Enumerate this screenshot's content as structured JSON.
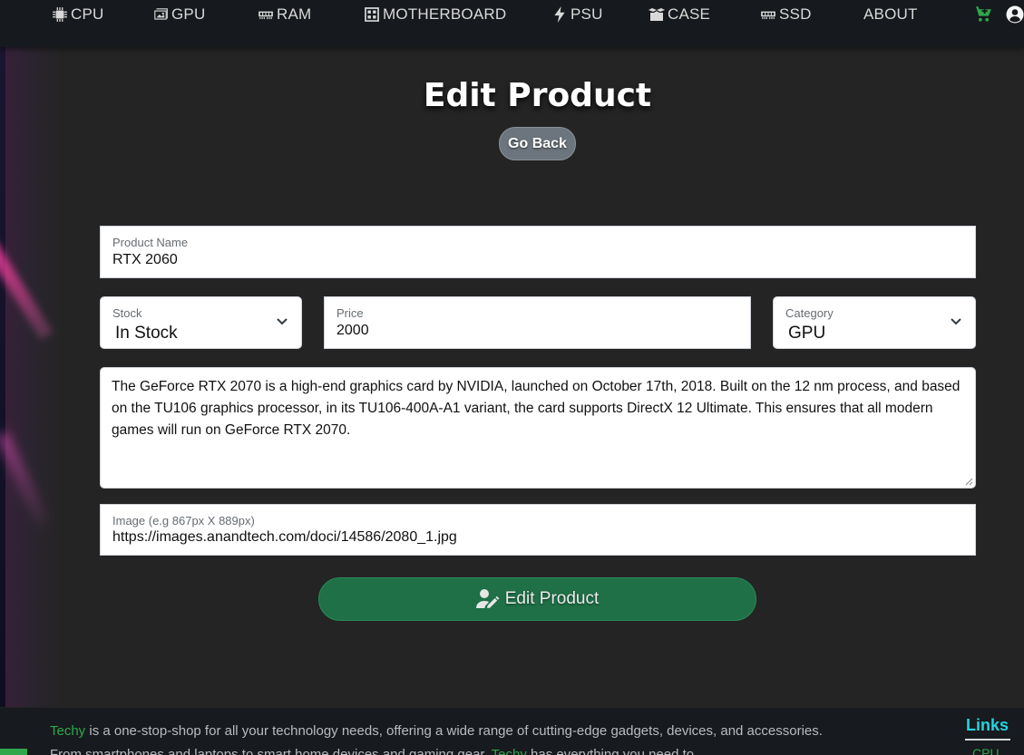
{
  "nav": {
    "items": [
      {
        "label": "CPU",
        "icon": "cpu-icon"
      },
      {
        "label": "GPU",
        "icon": "gpu-icon"
      },
      {
        "label": "RAM",
        "icon": "ram-icon"
      },
      {
        "label": "MOTHERBOARD",
        "icon": "motherboard-icon"
      },
      {
        "label": "PSU",
        "icon": "bolt-icon"
      },
      {
        "label": "CASE",
        "icon": "box-icon"
      },
      {
        "label": "SSD",
        "icon": "ssd-icon"
      },
      {
        "label": "ABOUT",
        "icon": ""
      }
    ],
    "cart_icon": "cart-icon",
    "user_icon": "user-icon"
  },
  "page": {
    "title": "Edit Product",
    "go_back": "Go Back"
  },
  "form": {
    "name": {
      "label": "Product Name",
      "value": "RTX 2060"
    },
    "stock": {
      "label": "Stock",
      "value": "In Stock"
    },
    "price": {
      "label": "Price",
      "value": "2000"
    },
    "category": {
      "label": "Category",
      "value": "GPU"
    },
    "description": "The GeForce RTX 2070 is a high-end graphics card by NVIDIA, launched on October 17th, 2018. Built on the 12 nm process, and based on the TU106 graphics processor, in its TU106-400A-A1 variant, the card supports DirectX 12 Ultimate. This ensures that all modern games will run on GeForce RTX 2070.",
    "image": {
      "label": "Image (e.g 867px X 889px)",
      "value": "https://images.anandtech.com/doci/14586/2080_1.jpg"
    },
    "submit": "Edit Product"
  },
  "footer": {
    "brand": "Techy",
    "about_1": " is a one-stop-shop for all your technology needs, offering a wide range of cutting-edge gadgets, devices, and accessories. From smartphones and laptops to smart home devices and gaming gear, ",
    "brand_2": "Techy",
    "about_2": " has everything you need to",
    "links_title": "Links",
    "links_first": "CPU"
  },
  "colors": {
    "background": "#242424",
    "navbar": "#16191d",
    "accent_green": "#2ea84a",
    "submit_green": "#1f6f47",
    "links_cyan": "#21d4e0",
    "go_back_gray": "#6c757d"
  }
}
